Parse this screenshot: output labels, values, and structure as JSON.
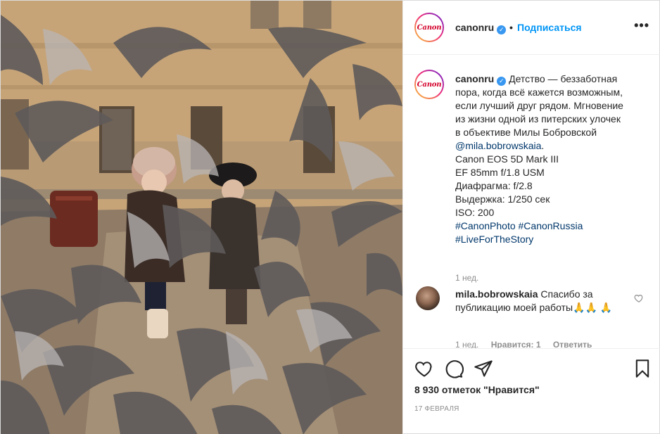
{
  "post": {
    "photo_alt": "",
    "colors": {
      "accent": "#0095f6",
      "link": "#00376b",
      "muted": "#8e8e8e",
      "canon_red": "#d3002a"
    }
  },
  "header": {
    "avatar_logo": "Canon",
    "username": "canonru",
    "verified_icon": "verified-badge-icon",
    "separator": "•",
    "follow_label": "Подписаться",
    "more_icon": "more-options-icon",
    "more_glyph": "•••"
  },
  "caption": {
    "avatar_logo": "Canon",
    "username": "canonru",
    "lines": [
      "Детство — беззаботная",
      "пора, когда всё кажется возможным,",
      "если лучший друг рядом. Мгновение",
      "из жизни одной из питерских улочек",
      "в объективе Милы Бобровской"
    ],
    "mention": "@mila.bobrowskaia",
    "mention_suffix": ".",
    "specs": [
      "Canon EOS 5D Mark III",
      "EF 85mm f/1.8 USM",
      "Диафрагма: f/2.8",
      "Выдержка: 1/250 сек",
      "ISO: 200"
    ],
    "hashtags_line1": "#CanonPhoto #CanonRussia",
    "hashtags_line2": "#LiveForTheStory",
    "time": "1 нед."
  },
  "comment": {
    "username": "mila.bobrowskaia",
    "text": "Спасибо за публикацию моей работы🙏🙏 🙏",
    "time": "1 нед.",
    "likes": "Нравится: 1",
    "reply_label": "Ответить",
    "heart_icon": "heart-outline-icon"
  },
  "actions": {
    "like_icon": "heart-icon",
    "comment_icon": "comment-icon",
    "share_icon": "share-icon",
    "save_icon": "bookmark-icon",
    "likes_text": "8 930 отметок \"Нравится\"",
    "date": "17 ФЕВРАЛЯ"
  }
}
